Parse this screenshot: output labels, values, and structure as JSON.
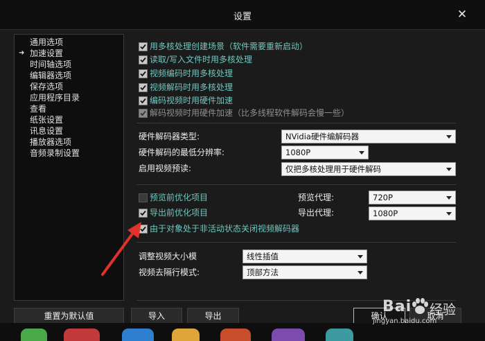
{
  "window": {
    "title": "设置",
    "close_symbol": "✕"
  },
  "sidebar": {
    "items": [
      {
        "label": "通用选项",
        "selected": false
      },
      {
        "label": "加速设置",
        "selected": true
      },
      {
        "label": "时间轴选项",
        "selected": false
      },
      {
        "label": "编辑器选项",
        "selected": false
      },
      {
        "label": "保存选项",
        "selected": false
      },
      {
        "label": "应用程序目录",
        "selected": false
      },
      {
        "label": "查看",
        "selected": false
      },
      {
        "label": "纸张设置",
        "selected": false
      },
      {
        "label": "讯息设置",
        "selected": false
      },
      {
        "label": "播放器选项",
        "selected": false
      },
      {
        "label": "音频录制设置",
        "selected": false
      }
    ]
  },
  "checkboxes": [
    {
      "label": "用多核处理创建场景（软件需要重新启动）",
      "checked": true,
      "disabled": false
    },
    {
      "label": "读取/写入文件时用多核处理",
      "checked": true,
      "disabled": false
    },
    {
      "label": "视频编码时用多核处理",
      "checked": true,
      "disabled": false
    },
    {
      "label": "视频解码时用多核处理",
      "checked": true,
      "disabled": false
    },
    {
      "label": "编码视频时用硬件加速",
      "checked": true,
      "disabled": false
    },
    {
      "label": "解码视频时用硬件加速（比多线程软件解码会慢一些）",
      "checked": true,
      "disabled": true
    }
  ],
  "hardware": {
    "decoder_type_label": "硬件解码器类型:",
    "decoder_type_value": "NVidia硬件编解码器",
    "min_resolution_label": "硬件解码的最低分辨率:",
    "min_resolution_value": "1080P",
    "preview_label": "启用视频预读:",
    "preview_value": "仅把多核处理用于硬件解码"
  },
  "proxy": {
    "preview_optimize_label": "预览前优化项目",
    "preview_optimize_checked": false,
    "export_optimize_label": "导出前优化项目",
    "export_optimize_checked": true,
    "preview_proxy_label": "预览代理:",
    "preview_proxy_value": "720P",
    "export_proxy_label": "导出代理:",
    "export_proxy_value": "1080P",
    "close_decoder_label": "由于对象处于非活动状态关闭视频解码器",
    "close_decoder_checked": true
  },
  "video": {
    "resize_label": "调整视频大小模",
    "resize_value": "线性插值",
    "deinterlace_label": "视频去隔行模式:",
    "deinterlace_value": "顶部方法"
  },
  "buttons": {
    "reset": "重置为默认值",
    "import": "导入",
    "export": "导出",
    "ok": "确认",
    "cancel": "取消"
  },
  "watermark": {
    "brand": "Bai",
    "brand_suffix": "经验",
    "url": "jingyan.baidu.com"
  },
  "colors": {
    "accent_text": "#6fc7c0",
    "annotation_arrow": "#e0322b"
  }
}
